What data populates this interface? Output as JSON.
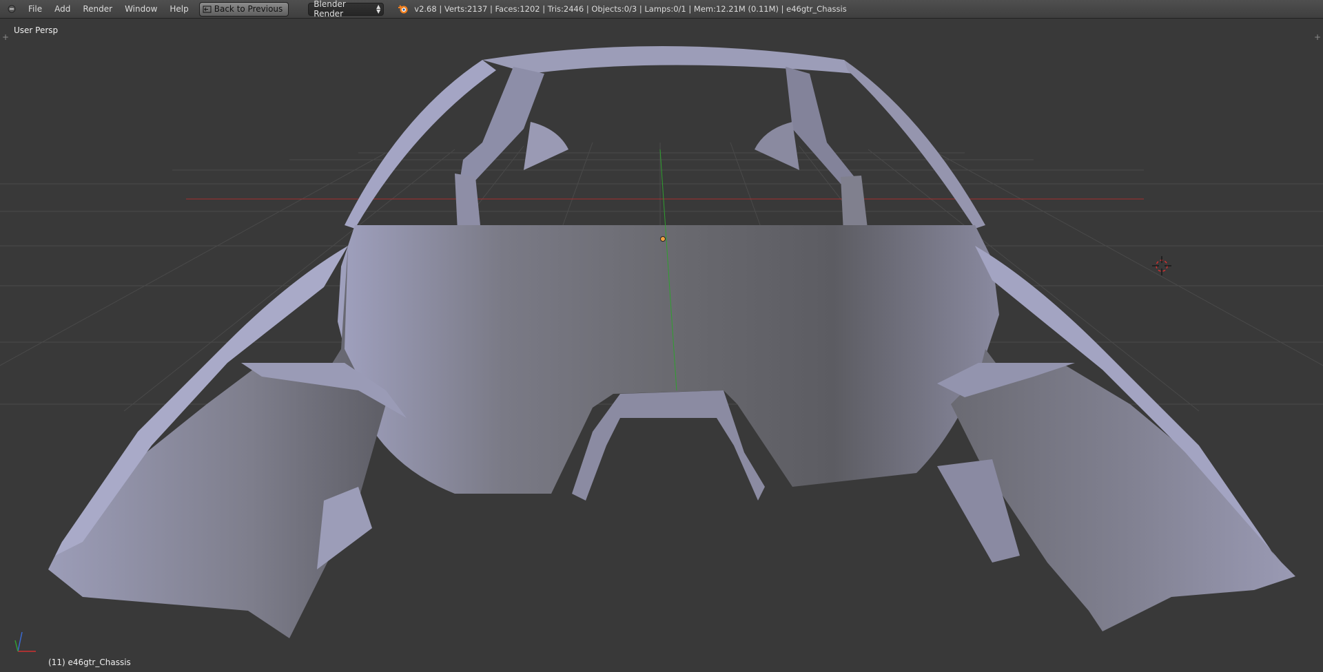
{
  "header": {
    "menus": [
      "File",
      "Add",
      "Render",
      "Window",
      "Help"
    ],
    "back_button": "Back to Previous",
    "render_engine": "Blender Render",
    "stats": "v2.68 | Verts:2137 | Faces:1202 | Tris:2446 | Objects:0/3 | Lamps:0/1 | Mem:12.21M (0.11M) | e46gtr_Chassis"
  },
  "viewport": {
    "view_name": "User Persp",
    "object_info": "(11) e46gtr_Chassis"
  },
  "colors": {
    "background": "#393939",
    "grid": "#4a4a4a",
    "x_axis": "#b03030",
    "y_axis": "#2fa02f",
    "mesh_light": "#a7a8c6",
    "mesh_mid": "#8c8c9e",
    "mesh_dark": "#6c6c74",
    "origin": "#f0a040"
  },
  "icons": {
    "area_toggle": "area-toggle-icon",
    "back": "back-to-previous-icon",
    "engine": "up-down-arrows-icon",
    "logo": "blender-logo-icon",
    "cursor": "3d-cursor-icon",
    "gizmo": "axis-gizmo-icon"
  }
}
